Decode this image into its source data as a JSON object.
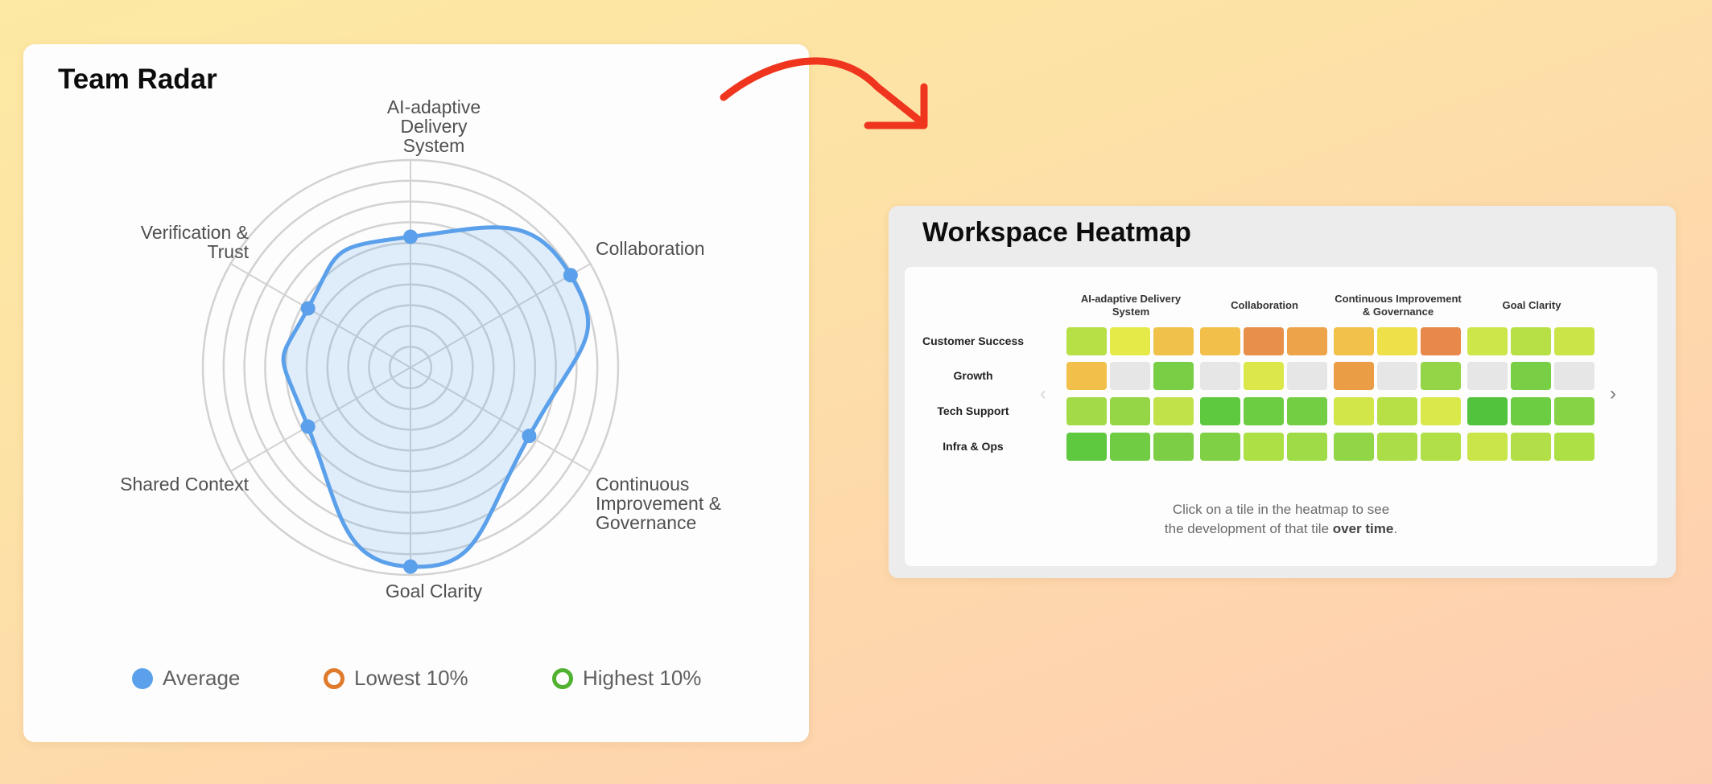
{
  "radar": {
    "title": "Team Radar",
    "axes": [
      "AI-adaptive Delivery System",
      "Collaboration",
      "Continuous Improvement & Governance",
      "Goal Clarity",
      "Shared Context",
      "Verification & Trust"
    ],
    "axis_lines": {
      "top": [
        "AI-adaptive",
        "Delivery",
        "System"
      ],
      "collab": [
        "Collaboration"
      ],
      "ci": [
        "Continuous",
        "Improvement &",
        "Governance"
      ],
      "goal": [
        "Goal Clarity"
      ],
      "shared": [
        "Shared Context"
      ],
      "verif": [
        "Verification &",
        "Trust"
      ]
    },
    "legend": {
      "average": "Average",
      "lowest": "Lowest 10%",
      "highest": "Highest 10%"
    },
    "colors": {
      "average": "#5ba0ea",
      "lowest": "#e07b2c",
      "highest": "#50b230",
      "grid": "#d2d2d2"
    }
  },
  "chart_data": {
    "type": "radar",
    "categories": [
      "AI-adaptive Delivery System",
      "Collaboration",
      "Continuous Improvement & Governance",
      "Goal Clarity",
      "Shared Context",
      "Verification & Trust"
    ],
    "series": [
      {
        "name": "Average",
        "values": [
          0.63,
          0.89,
          0.66,
          0.96,
          0.57,
          0.57
        ]
      }
    ],
    "rlim": [
      0,
      1
    ],
    "rings": 10,
    "legend": [
      "Average",
      "Lowest 10%",
      "Highest 10%"
    ],
    "legend_position": "bottom"
  },
  "heatmap": {
    "title": "Workspace Heatmap",
    "groups": [
      "AI-adaptive Delivery System",
      "Collaboration",
      "Continuous Improvement & Governance",
      "Goal Clarity"
    ],
    "rows": [
      {
        "label": "Customer Success",
        "tiles": [
          "#b6e045",
          "#e6ea49",
          "#f1c24a",
          "#f2c04a",
          "#e8904a",
          "#eca34a",
          "#f2c14a",
          "#ede049",
          "#e8884a",
          "#cde649",
          "#b6e045",
          "#cbe549"
        ]
      },
      {
        "label": "Growth",
        "tiles": [
          "#f2c04a",
          "#e6e6e6",
          "#78cf45",
          "#e6e6e6",
          "#dce84a",
          "#e6e6e6",
          "#eb9d46",
          "#e6e6e6",
          "#93d546",
          "#e6e6e6",
          "#78cf45",
          "#e6e6e6"
        ]
      },
      {
        "label": "Tech Support",
        "tiles": [
          "#a3da48",
          "#95d647",
          "#c1e349",
          "#5ec83f",
          "#6ccc42",
          "#74ce43",
          "#d2e64a",
          "#b6e045",
          "#dbe84a",
          "#52c33d",
          "#6ccc42",
          "#86d346"
        ]
      },
      {
        "label": "Infra & Ops",
        "tiles": [
          "#5ec83f",
          "#70cc42",
          "#7ccf44",
          "#80d045",
          "#ace045",
          "#9edb46",
          "#91d646",
          "#aadd47",
          "#b0df47",
          "#c9e54a",
          "#b2df47",
          "#ace045"
        ]
      }
    ],
    "nav": {
      "prev": "‹",
      "next": "›"
    },
    "caption_line1": "Click on a tile in the heatmap to see",
    "caption_line2_prefix": "the development of that tile ",
    "caption_line2_bold": "over time",
    "caption_line2_suffix": "."
  },
  "arrow_color": "#f0351f"
}
